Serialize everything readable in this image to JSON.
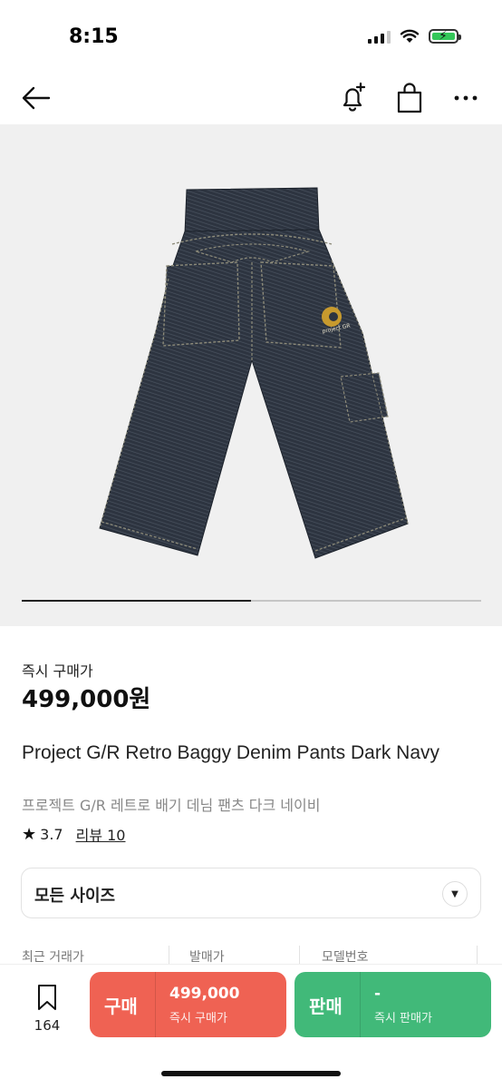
{
  "status_bar": {
    "time": "8:15"
  },
  "product": {
    "price_label": "즉시 구매가",
    "price": "499,000원",
    "title_en": "Project G/R Retro Baggy Denim Pants Dark Navy",
    "title_ko": "프로젝트 G/R 레트로 배기 데님 팬츠 다크 네이비",
    "rating": "3.7",
    "review_link": "리뷰 10",
    "logo_text": "project GR"
  },
  "size_select": {
    "label": "모든 사이즈"
  },
  "stats": {
    "recent_trade": "최근 거래가",
    "release_price": "발매가",
    "model_number": "모델번호"
  },
  "bottom_bar": {
    "bookmark_count": "164",
    "buy": {
      "label": "구매",
      "price": "499,000",
      "sub": "즉시 구매가"
    },
    "sell": {
      "label": "판매",
      "price": "-",
      "sub": "즉시 판매가"
    }
  },
  "colors": {
    "buy": "#ef6253",
    "sell": "#41b979",
    "denim": "#2d3440",
    "hero_bg": "#f0f0f0"
  },
  "icons": [
    "back-arrow-icon",
    "bell-plus-icon",
    "shopping-bag-icon",
    "more-icon",
    "star-icon",
    "chevron-down-icon",
    "bookmark-icon"
  ]
}
